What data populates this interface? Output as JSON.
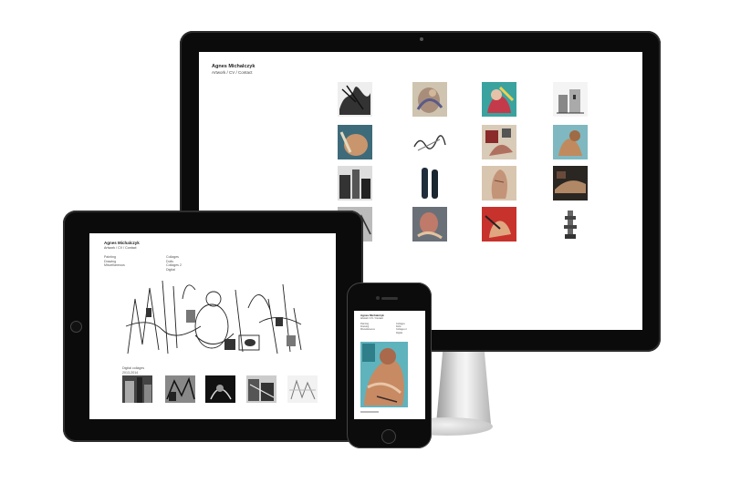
{
  "site": {
    "artist_name": "Agnes Michalczyk",
    "nav": "Artwork / CV / Contact"
  },
  "tablet": {
    "menu_left": [
      "Painting",
      "Drawing",
      "Miscellaneous"
    ],
    "menu_right": [
      "Collages",
      "Dolls",
      "Collages 2",
      "Digital"
    ],
    "gallery_caption": [
      "Digital collages",
      "2013-2014"
    ]
  },
  "phone": {
    "menu_left": [
      "Painting",
      "Drawing",
      "Miscellaneous"
    ],
    "menu_right": [
      "Collages",
      "Dolls",
      "Collages 2",
      "Digital"
    ]
  },
  "colors": {
    "device_bezel": "#0b0b0b",
    "screen_bg": "#ffffff",
    "text_dark": "#222222"
  },
  "icons": [
    "camera-icon",
    "home-button-icon",
    "speaker-icon"
  ]
}
